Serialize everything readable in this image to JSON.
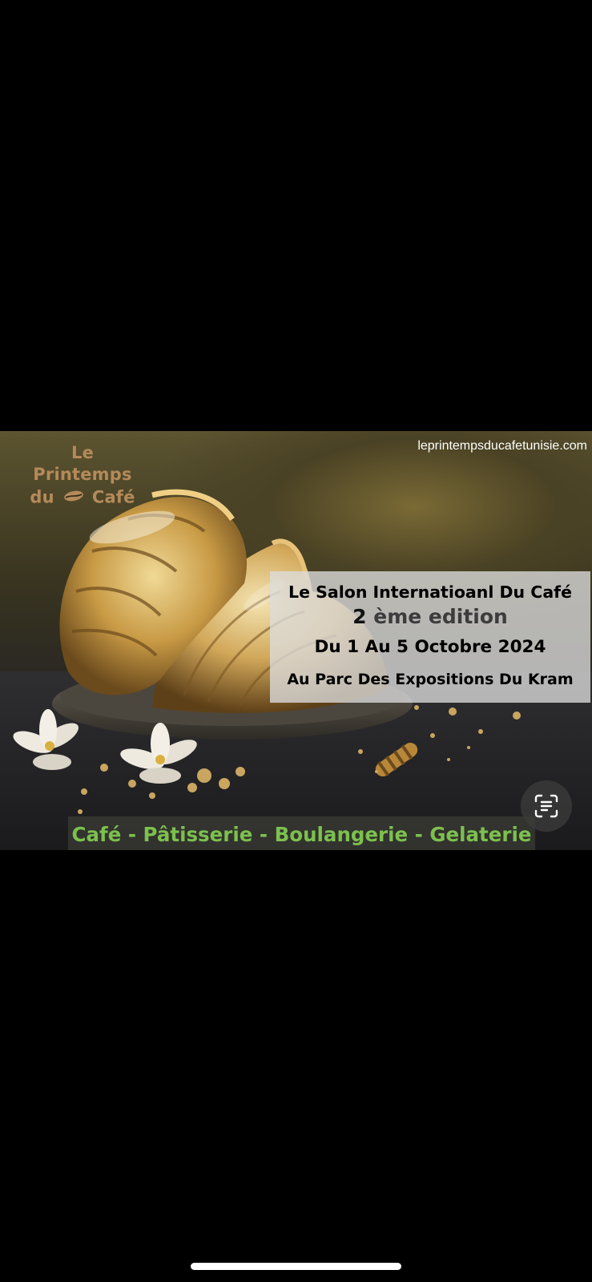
{
  "poster": {
    "logo_line1": "Le Printemps",
    "logo_du": "du",
    "logo_cafe": "Café",
    "website": "leprintempsducafetunisie.com",
    "title": "Le Salon Internatioanl Du Café",
    "edition_number": "2",
    "edition_text": "ème edition",
    "dates": "Du 1 Au 5 Octobre 2024",
    "venue": "Au Parc Des Expositions Du Kram",
    "tagline": "Café - Pâtisserie - Boulangerie - Gelaterie"
  },
  "colors": {
    "logo": "#b48a5a",
    "tagline": "#7cc04e",
    "background": "#000000"
  },
  "icons": {
    "live_text": "live-text-icon",
    "coffee_bean": "coffee-bean-icon"
  }
}
